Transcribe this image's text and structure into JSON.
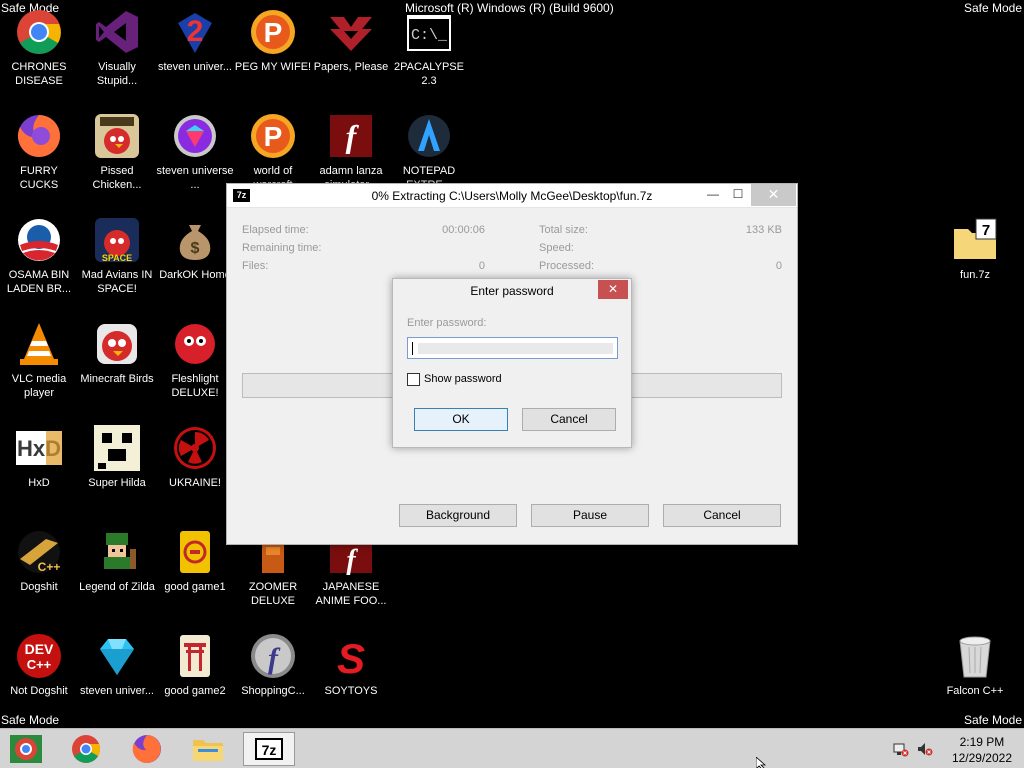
{
  "desktop": {
    "safe_mode": "Safe Mode",
    "build": "Microsoft (R) Windows (R) (Build 9600)",
    "icons": [
      {
        "label": "CHRONES DISEASE",
        "icon": "chrome-icon"
      },
      {
        "label": "Visually Stupid...",
        "icon": "visual-studio-icon"
      },
      {
        "label": "steven univer...",
        "icon": "number-2-icon"
      },
      {
        "label": "PEG MY WIFE!",
        "icon": "peggle-icon"
      },
      {
        "label": "Papers, Please",
        "icon": "papers-please-icon"
      },
      {
        "label": "2PACALYPSE 2.3",
        "icon": "console-icon"
      },
      {
        "label": "FURRY CUCKS",
        "icon": "firefox-icon"
      },
      {
        "label": "Pissed Chicken...",
        "icon": "angry-birds-seasons-icon"
      },
      {
        "label": "steven universe ...",
        "icon": "gem-icon"
      },
      {
        "label": "world of warcraft",
        "icon": "peggle-icon"
      },
      {
        "label": "adamn lanza simulator...",
        "icon": "flash-icon"
      },
      {
        "label": "NOTEPAD EXTRE...",
        "icon": "notepad-extreme-icon"
      },
      {
        "label": "OSAMA BIN LADEN BR...",
        "icon": "obama-logo-icon"
      },
      {
        "label": "Mad Avians IN SPACE!",
        "icon": "angry-birds-space-icon"
      },
      {
        "label": "DarkOK Home",
        "icon": "money-bag-icon"
      },
      {
        "label": "fun.7z",
        "icon": "7z-folder-icon"
      },
      {
        "label": "VLC media player",
        "icon": "vlc-icon"
      },
      {
        "label": "Minecraft Birds",
        "icon": "angry-bird-icon"
      },
      {
        "label": "Fleshlight DELUXE!",
        "icon": "red-fuzzball-icon"
      },
      {
        "label": "HxD",
        "icon": "hxd-icon"
      },
      {
        "label": "Super Hilda",
        "icon": "pixel-dog-icon"
      },
      {
        "label": "UKRAINE!",
        "icon": "radiation-icon"
      },
      {
        "label": "Dogshit",
        "icon": "cpp-icon"
      },
      {
        "label": "Legend of Zilda",
        "icon": "pixel-hero-icon"
      },
      {
        "label": "good game1",
        "icon": "mahjong-tile-icon"
      },
      {
        "label": "ZOOMER DELUXE",
        "icon": "zoomer-icon"
      },
      {
        "label": "JAPANESE ANIME FOO...",
        "icon": "flash-icon"
      },
      {
        "label": "Not Dogshit",
        "icon": "dev-cpp-icon"
      },
      {
        "label": "steven univer...",
        "icon": "diamond-icon"
      },
      {
        "label": "good game2",
        "icon": "torii-tile-icon"
      },
      {
        "label": "ShoppingC...",
        "icon": "flash-player-icon"
      },
      {
        "label": "SOYTOYS",
        "icon": "red-s-icon"
      },
      {
        "label": "Falcon C++",
        "icon": "recycle-bin-icon"
      }
    ]
  },
  "extract_window": {
    "app_icon": "7z",
    "title": "0% Extracting C:\\Users\\Molly McGee\\Desktop\\fun.7z",
    "elapsed_label": "Elapsed time:",
    "elapsed_value": "00:00:06",
    "remaining_label": "Remaining time:",
    "files_label": "Files:",
    "files_value": "0",
    "total_label": "Total size:",
    "total_value": "133 KB",
    "speed_label": "Speed:",
    "processed_label": "Processed:",
    "processed_value": "0",
    "progress": 0,
    "background_label": "Background",
    "pause_label": "Pause",
    "cancel_label": "Cancel"
  },
  "password_dialog": {
    "title": "Enter password",
    "field_label": "Enter password:",
    "value": "",
    "show_label": "Show password",
    "show_checked": false,
    "ok_label": "OK",
    "cancel_label": "Cancel"
  },
  "taskbar": {
    "apps": [
      "chrome-metro-icon",
      "chrome-icon",
      "firefox-icon",
      "file-explorer-icon",
      "7zip-icon"
    ],
    "active": "7zip-icon",
    "time": "2:19 PM",
    "date": "12/29/2022"
  }
}
